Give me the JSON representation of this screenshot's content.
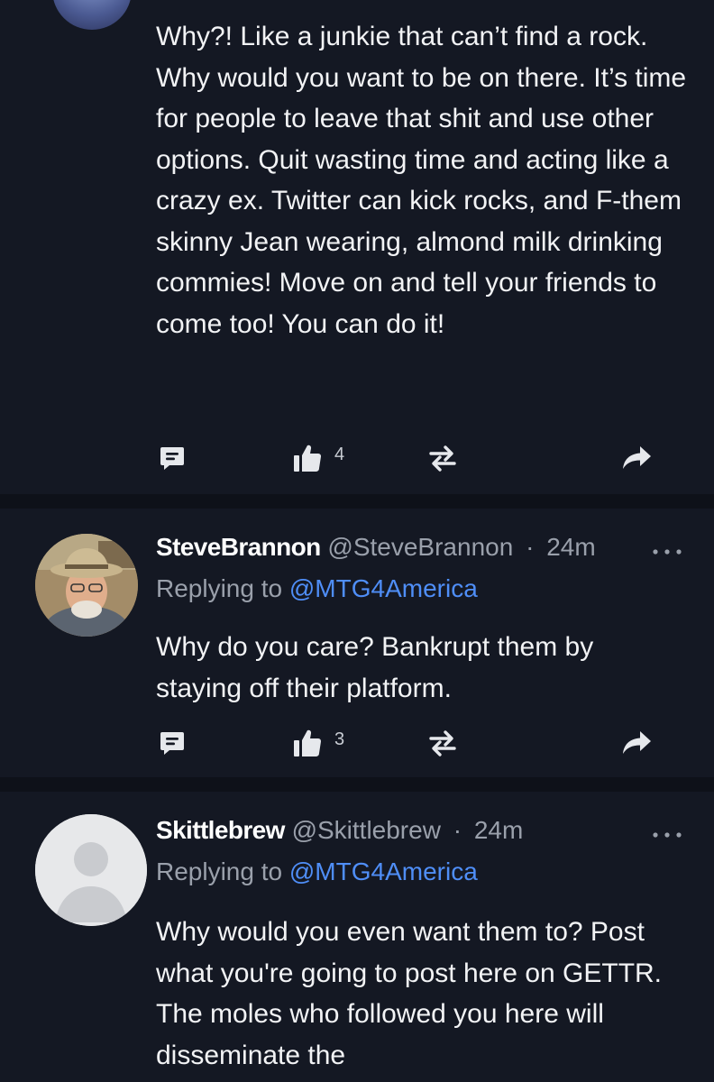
{
  "posts": [
    {
      "text": "Why?! Like a junkie that can’t find a rock. Why would you want to be on there. It’s time for people to leave that shit and use other options. Quit wasting time and acting like a crazy ex. Twitter can kick rocks, and F-them skinny Jean wearing, almond milk drinking commies! Move on and tell your friends to come too! You can do it!",
      "like_count": "4"
    },
    {
      "display_name": "SteveBrannon",
      "handle": "@SteveBrannon",
      "separator": "·",
      "time": "24m",
      "replying_prefix": "Replying to",
      "replying_to": "@MTG4America",
      "text": "Why do you care? Bankrupt them by staying off their platform.",
      "like_count": "3"
    },
    {
      "display_name": "Skittlebrew",
      "handle": "@Skittlebrew",
      "separator": "·",
      "time": "24m",
      "replying_prefix": "Replying to",
      "replying_to": "@MTG4America",
      "text": "Why would you even want them to? Post what you're going to post here on GETTR. The moles who followed you here will disseminate the"
    }
  ],
  "icons": {
    "comment": "comment-icon",
    "like": "thumbs-up-icon",
    "repost": "repost-icon",
    "share": "share-arrow-icon",
    "more": "more-dots-icon"
  },
  "colors": {
    "background": "#141823",
    "separator": "#0e1119",
    "text": "#f2f3f5",
    "muted": "#9aa0ab",
    "link": "#4f8ef7"
  }
}
